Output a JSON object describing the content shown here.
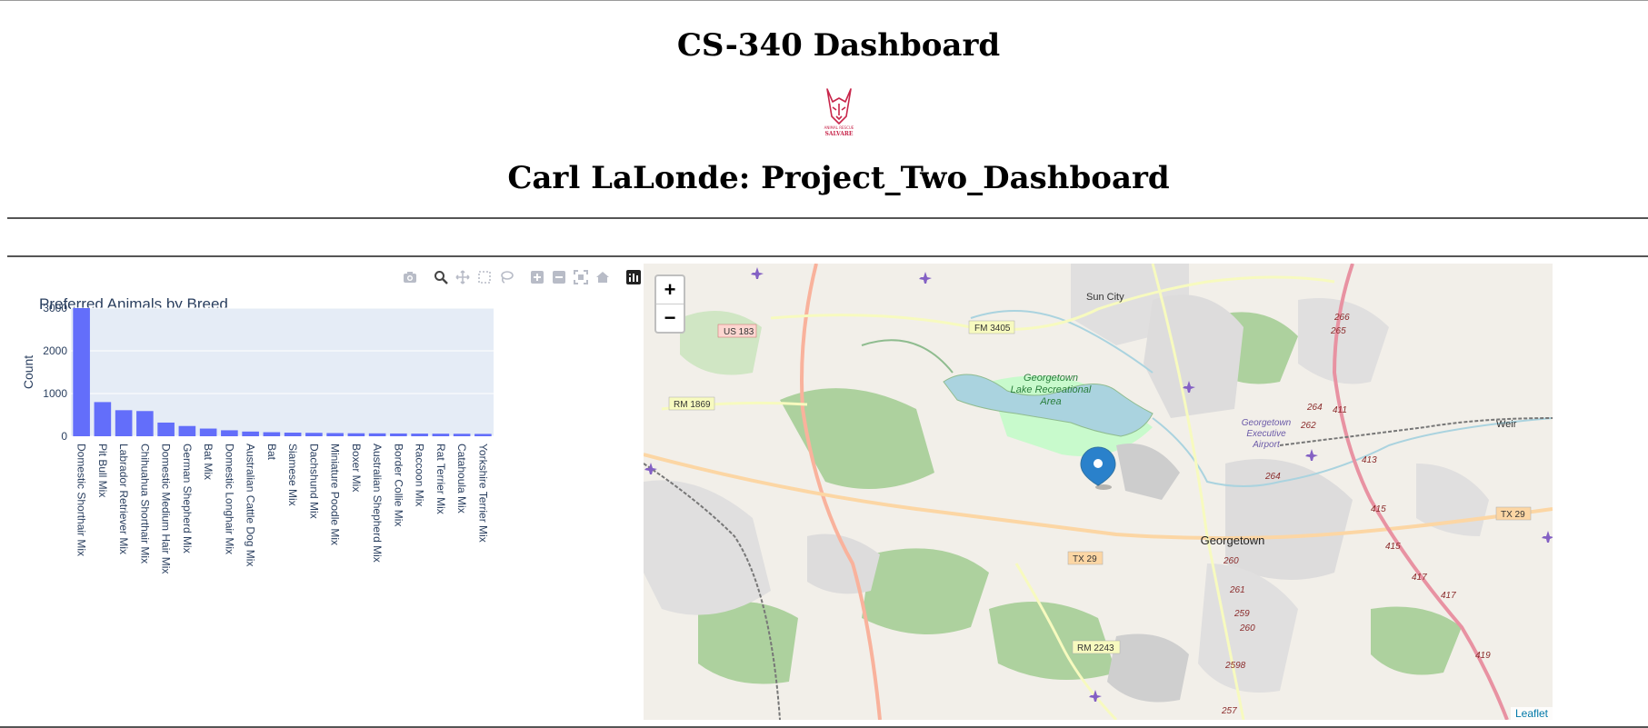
{
  "header": {
    "title": "CS-340 Dashboard",
    "logo_text": "SALVARE",
    "subtitle": "Carl LaLonde: Project_Two_Dashboard"
  },
  "modebar": {
    "icons": [
      "camera-icon",
      "zoom-icon",
      "pan-icon",
      "box-select-icon",
      "lasso-select-icon",
      "zoom-in-icon",
      "zoom-out-icon",
      "autoscale-icon",
      "reset-axes-icon",
      "plotly-logo-icon"
    ]
  },
  "chart_data": {
    "type": "bar",
    "title": "Preferred Animals by Breed",
    "xlabel": "",
    "ylabel": "Count",
    "ylim": [
      0,
      3000
    ],
    "yticks": [
      0,
      1000,
      2000,
      3000
    ],
    "bar_color": "#636efa",
    "plot_bg": "#e5ecf6",
    "categories": [
      "Domestic Shorthair Mix",
      "Pit Bull Mix",
      "Labrador Retriever Mix",
      "Chihuahua Shorthair Mix",
      "Domestic Medium Hair Mix",
      "German Shepherd Mix",
      "Bat Mix",
      "Domestic Longhair Mix",
      "Australian Cattle Dog Mix",
      "Bat",
      "Siamese Mix",
      "Dachshund Mix",
      "Miniature Poodle Mix",
      "Boxer Mix",
      "Australian Shepherd Mix",
      "Border Collie Mix",
      "Raccoon Mix",
      "Rat Terrier Mix",
      "Catahoula Mix",
      "Yorkshire Terrier Mix"
    ],
    "values": [
      3000,
      800,
      610,
      590,
      320,
      240,
      180,
      140,
      110,
      95,
      85,
      80,
      75,
      70,
      68,
      65,
      62,
      60,
      58,
      55
    ]
  },
  "map": {
    "zoom_in": "+",
    "zoom_out": "−",
    "attribution": "Leaflet",
    "labels": {
      "sun_city": "Sun City",
      "fm3405": "FM 3405",
      "us183": "US 183",
      "rm1869": "RM 1869",
      "lake1": "Georgetown",
      "lake2": "Lake Recreational",
      "lake3": "Area",
      "airport1": "Georgetown",
      "airport2": "Executive",
      "airport3": "Airport",
      "weir": "Weir",
      "tx29_left": "TX 29",
      "tx29_right": "TX 29",
      "georgetown": "Georgetown",
      "rm2243": "RM 2243",
      "r266": "266",
      "r265": "265",
      "r264a": "264",
      "r411": "411",
      "r262": "262",
      "r413": "413",
      "r264b": "264",
      "r415a": "415",
      "r415b": "415",
      "r417a": "417",
      "r417b": "417",
      "r260a": "260",
      "r261": "261",
      "r259": "259",
      "r260b": "260",
      "r2598": "2598",
      "r419": "419",
      "r257": "257"
    }
  }
}
